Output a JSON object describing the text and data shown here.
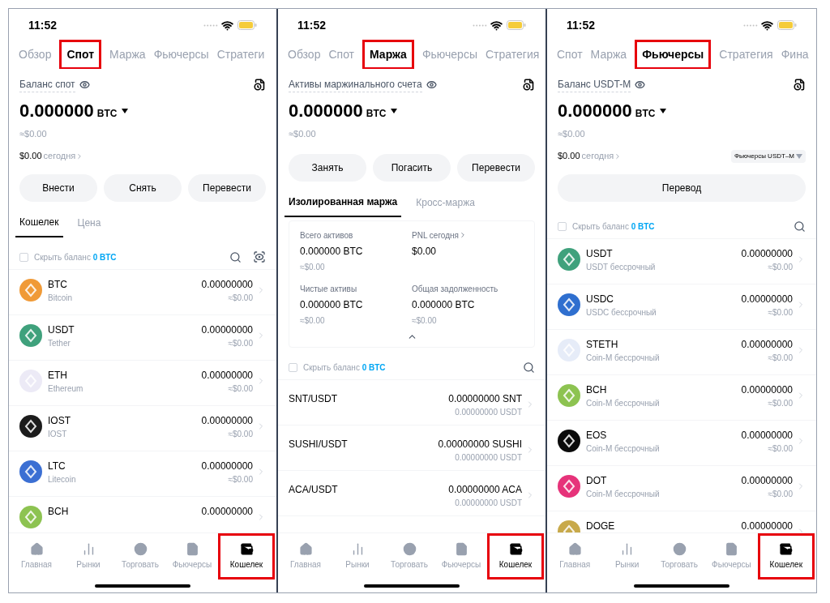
{
  "screens": [
    {
      "time": "11:52",
      "tabs": [
        {
          "label": "Обзор",
          "selected": false
        },
        {
          "label": "Спот",
          "selected": true
        },
        {
          "label": "Маржа",
          "selected": false
        },
        {
          "label": "Фьючерсы",
          "selected": false
        },
        {
          "label": "Стратеги",
          "selected": false
        }
      ],
      "balance": {
        "label": "Баланс спот",
        "amount": "0.000000",
        "unit": "BTC",
        "usd": "≈$0.00",
        "today_amount": "$0.00",
        "today_label": "сегодня"
      },
      "actions": [
        "Внести",
        "Снять",
        "Перевести"
      ],
      "subtabs": [
        {
          "label": "Кошелек",
          "selected": true
        },
        {
          "label": "Цена",
          "selected": false
        }
      ],
      "hide_balance": {
        "label": "Скрыть баланс",
        "value": "0 BTC",
        "checked": false,
        "scan_button": true
      },
      "rows": [
        {
          "kind": "coin",
          "symbol": "BTC",
          "name": "Bitcoin",
          "amount": "0.00000000",
          "usd": "≈$0.00",
          "color": "#f09a37"
        },
        {
          "kind": "coin",
          "symbol": "USDT",
          "name": "Tether",
          "amount": "0.00000000",
          "usd": "≈$0.00",
          "color": "#3fa17c"
        },
        {
          "kind": "coin",
          "symbol": "ETH",
          "name": "Ethereum",
          "amount": "0.00000000",
          "usd": "≈$0.00",
          "color": "#eceaf6"
        },
        {
          "kind": "coin",
          "symbol": "IOST",
          "name": "IOST",
          "amount": "0.00000000",
          "usd": "≈$0.00",
          "color": "#1c1c1c"
        },
        {
          "kind": "coin",
          "symbol": "LTC",
          "name": "Litecoin",
          "amount": "0.00000000",
          "usd": "≈$0.00",
          "color": "#3b6fd3"
        },
        {
          "kind": "coin",
          "symbol": "BCH",
          "amount": "0.00000000",
          "color": "#8dc351"
        }
      ],
      "nav": [
        {
          "label": "Главная",
          "selected": false
        },
        {
          "label": "Рынки",
          "selected": false
        },
        {
          "label": "Торговать",
          "selected": false
        },
        {
          "label": "Фьючерсы",
          "selected": false
        },
        {
          "label": "Кошелек",
          "selected": true
        }
      ]
    },
    {
      "time": "11:52",
      "tabs": [
        {
          "label": "Обзор",
          "selected": false
        },
        {
          "label": "Спот",
          "selected": false
        },
        {
          "label": "Маржа",
          "selected": true
        },
        {
          "label": "Фьючерсы",
          "selected": false
        },
        {
          "label": "Стратегия",
          "selected": false
        }
      ],
      "balance": {
        "label": "Активы маржинального счета",
        "amount": "0.000000",
        "unit": "BTC",
        "usd": "≈$0.00"
      },
      "actions": [
        "Занять",
        "Погасить",
        "Перевести"
      ],
      "subtabs": [
        {
          "label": "Изолированная маржа",
          "selected": true
        },
        {
          "label": "Кросс-маржа",
          "selected": false
        }
      ],
      "summary": {
        "stats": [
          {
            "label": "Всего активов",
            "value": "0.000000 BTC",
            "usd": "≈$0.00"
          },
          {
            "label": "PNL сегодня",
            "value": "$0.00",
            "link": true
          },
          {
            "label": "Чистые активы",
            "value": "0.000000 BTC",
            "usd": "≈$0.00"
          },
          {
            "label": "Общая задолженность",
            "value": "0.000000 BTC",
            "usd": "≈$0.00"
          }
        ]
      },
      "hide_balance": {
        "label": "Скрыть баланс",
        "value": "0 BTC",
        "checked": false
      },
      "rows": [
        {
          "kind": "pair",
          "pair": "SNT/USDT",
          "amount": "0.00000000 SNT",
          "sub": "0.00000000 USDT"
        },
        {
          "kind": "pair",
          "pair": "SUSHI/USDT",
          "amount": "0.00000000 SUSHI",
          "sub": "0.00000000 USDT"
        },
        {
          "kind": "pair",
          "pair": "ACA/USDT",
          "amount": "0.00000000 ACA",
          "sub": "0.00000000 USDT"
        }
      ],
      "nav": [
        {
          "label": "Главная",
          "selected": false
        },
        {
          "label": "Рынки",
          "selected": false
        },
        {
          "label": "Торговать",
          "selected": false
        },
        {
          "label": "Фьючерсы",
          "selected": false
        },
        {
          "label": "Кошелек",
          "selected": true
        }
      ]
    },
    {
      "time": "11:52",
      "tabs": [
        {
          "label": "Спот",
          "selected": false
        },
        {
          "label": "Маржа",
          "selected": false
        },
        {
          "label": "Фьючерсы",
          "selected": true
        },
        {
          "label": "Стратегия",
          "selected": false
        },
        {
          "label": "Фина",
          "selected": false
        }
      ],
      "balance": {
        "label": "Баланс USDT-M",
        "amount": "0.000000",
        "unit": "BTC",
        "usd": "≈$0.00",
        "today_amount": "$0.00",
        "today_label": "сегодня",
        "selector": "Фьючерсы USDT–M"
      },
      "actions": [
        "Перевод"
      ],
      "hide_balance": {
        "label": "Скрыть баланс",
        "value": "0 BTC",
        "checked": false
      },
      "rows": [
        {
          "kind": "coin",
          "symbol": "USDT",
          "name": "USDT бессрочный",
          "amount": "0.00000000",
          "usd": "≈$0.00",
          "color": "#3fa17c"
        },
        {
          "kind": "coin",
          "symbol": "USDC",
          "name": "USDC бессрочный",
          "amount": "0.00000000",
          "usd": "≈$0.00",
          "color": "#2f6fcf"
        },
        {
          "kind": "coin",
          "symbol": "STETH",
          "name": "Coin-M бессрочный",
          "amount": "0.00000000",
          "usd": "≈$0.00",
          "color": "#e6ecf8"
        },
        {
          "kind": "coin",
          "symbol": "BCH",
          "name": "Coin-M бессрочный",
          "amount": "0.00000000",
          "usd": "≈$0.00",
          "color": "#8dc351"
        },
        {
          "kind": "coin",
          "symbol": "EOS",
          "name": "Coin-M бессрочный",
          "amount": "0.00000000",
          "usd": "≈$0.00",
          "color": "#0b0b0b"
        },
        {
          "kind": "coin",
          "symbol": "DOT",
          "name": "Coin-M бессрочный",
          "amount": "0.00000000",
          "usd": "≈$0.00",
          "color": "#e6337a"
        },
        {
          "kind": "coin",
          "symbol": "DOGE",
          "amount": "0.00000000",
          "color": "#c8a94a"
        }
      ],
      "nav": [
        {
          "label": "Главная",
          "selected": false
        },
        {
          "label": "Рынки",
          "selected": false
        },
        {
          "label": "Торговать",
          "selected": false
        },
        {
          "label": "Фьючерсы",
          "selected": false
        },
        {
          "label": "Кошелек",
          "selected": true
        }
      ]
    }
  ]
}
